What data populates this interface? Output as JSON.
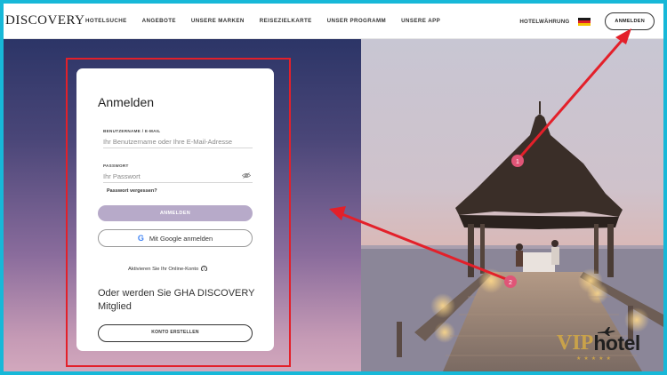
{
  "header": {
    "logo": "DISCOVERY",
    "nav": [
      "HOTELSUCHE",
      "ANGEBOTE",
      "UNSERE MARKEN",
      "REISEZIELKARTE",
      "UNSER PROGRAMM",
      "UNSERE APP"
    ],
    "currency_label": "HOTELWÄHRUNG",
    "login_label": "ANMELDEN",
    "flag_colors": [
      "#1a1a1a",
      "#dd1f26",
      "#f5c400"
    ]
  },
  "login_card": {
    "title": "Anmelden",
    "username_label": "BENUTZERNAME / E-MAIL",
    "username_placeholder": "Ihr Benutzername oder Ihre E-Mail-Adresse",
    "password_label": "PASSWORT",
    "password_placeholder": "Ihr Passwort",
    "forgot_label": "Passwort vergessen?",
    "submit_label": "ANMELDEN",
    "google_label": "Mit Google anmelden",
    "google_icon": "G",
    "activate_label": "Aktivieren Sie Ihr Online-Konto",
    "info_icon": "i"
  },
  "register_card": {
    "title": "Oder werden Sie GHA DISCOVERY Mitglied",
    "create_label": "KONTO ERSTELLEN"
  },
  "annotations": {
    "step1": "1",
    "step2": "2",
    "highlight_color": "#e3202a"
  },
  "watermark": {
    "brand_a": "VIP",
    "brand_b": "hotel",
    "stars": "★★★★★",
    "gold": "#c9a24a"
  }
}
